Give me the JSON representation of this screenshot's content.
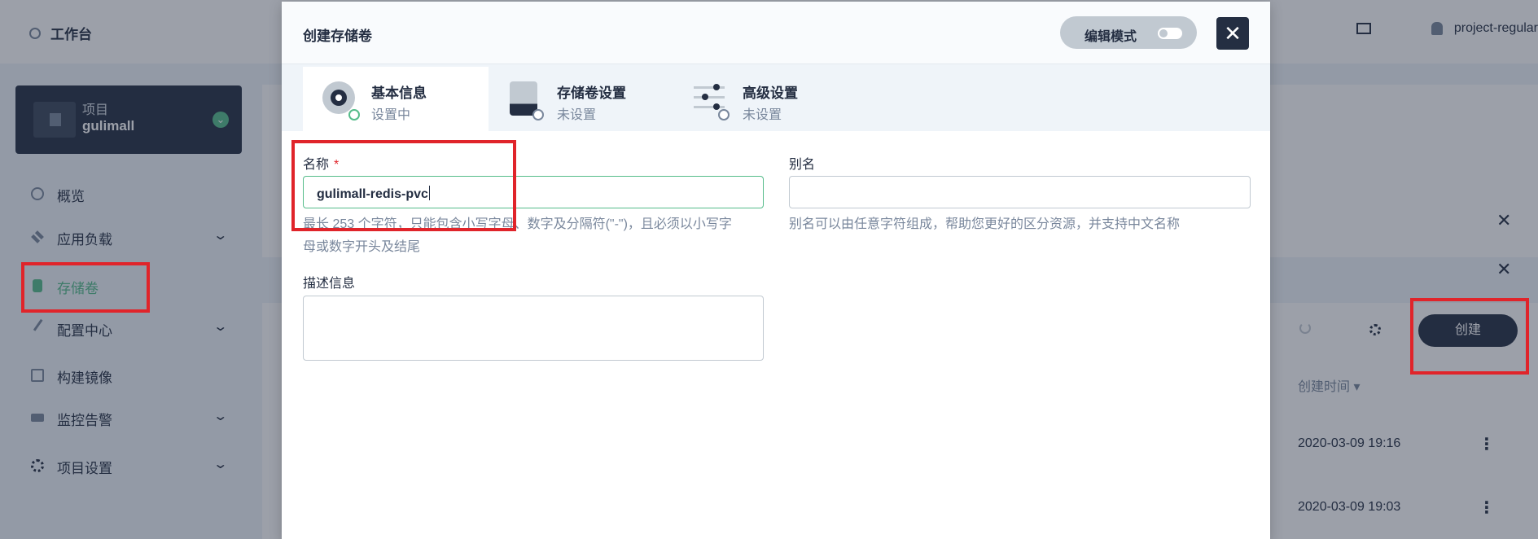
{
  "topbar": {
    "workbench": "工作台",
    "user": "project-regular"
  },
  "sidebar": {
    "project_type": "项目",
    "project_name": "gulimall",
    "items": [
      {
        "label": "概览"
      },
      {
        "label": "应用负载"
      },
      {
        "label": "存储卷"
      },
      {
        "label": "配置中心"
      },
      {
        "label": "构建镜像"
      },
      {
        "label": "监控告警"
      },
      {
        "label": "项目设置"
      }
    ]
  },
  "list": {
    "create_button": "创建",
    "column_created": "创建时间",
    "rows": [
      {
        "created": "2020-03-09 19:16"
      },
      {
        "created": "2020-03-09 19:03"
      }
    ]
  },
  "modal": {
    "title": "创建存储卷",
    "edit_mode": "编辑模式",
    "tabs": [
      {
        "title": "基本信息",
        "status": "设置中"
      },
      {
        "title": "存储卷设置",
        "status": "未设置"
      },
      {
        "title": "高级设置",
        "status": "未设置"
      }
    ],
    "form": {
      "name_label": "名称",
      "name_required": "*",
      "name_value": "gulimall-redis-pvc",
      "name_hint_line1": "最长 253 个字符，只能包含小写字母、数字及分隔符(\"-\")，且必须以小写字",
      "name_hint_line2": "母或数字开头及结尾",
      "alias_label": "别名",
      "alias_value": "",
      "alias_hint": "别名可以由任意字符组成，帮助您更好的区分资源，并支持中文名称",
      "desc_label": "描述信息",
      "desc_value": ""
    }
  },
  "colors": {
    "accent": "#55bc8a",
    "dark": "#242e42",
    "highlight": "#e0242a"
  }
}
